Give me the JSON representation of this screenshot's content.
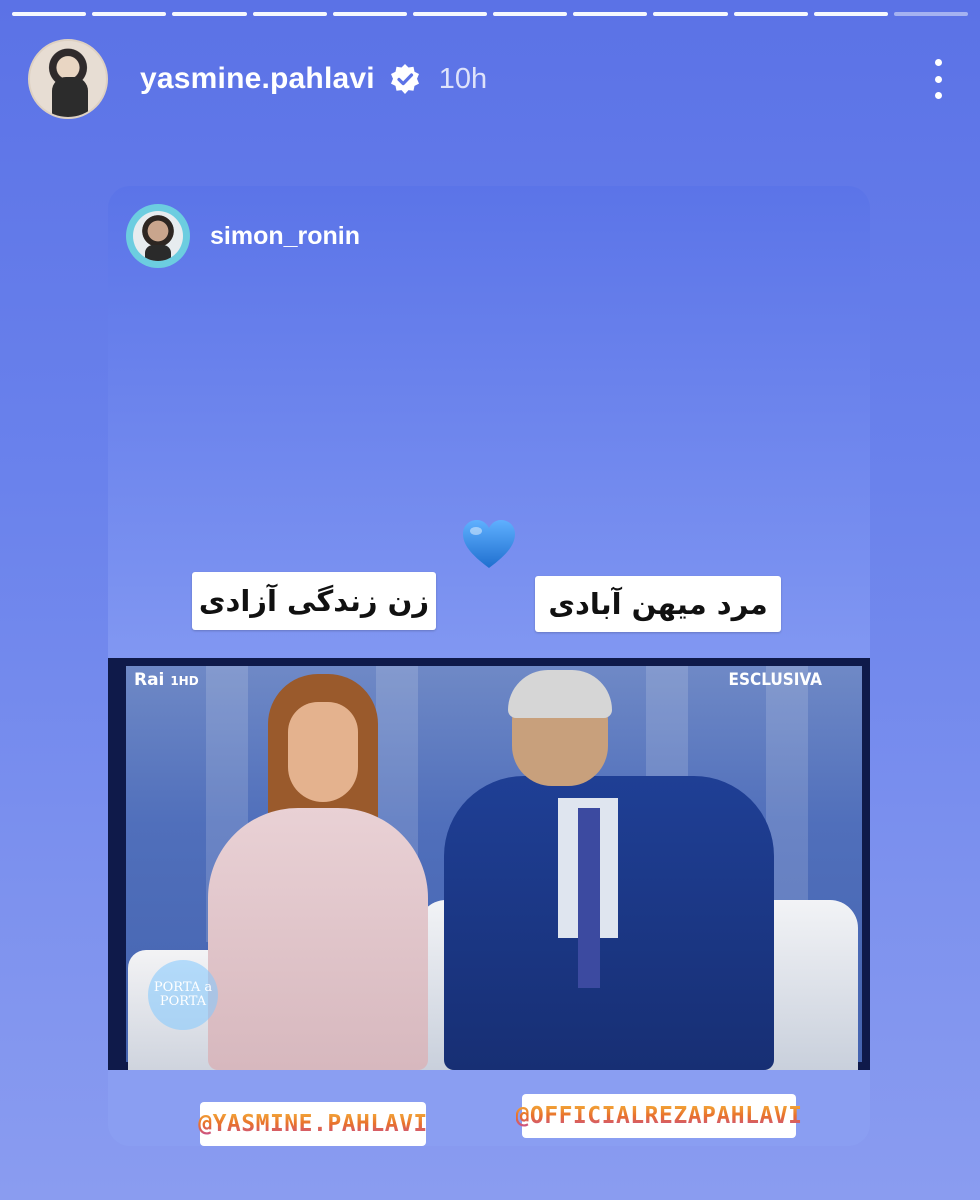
{
  "story": {
    "segments_total": 12,
    "author": "yasmine.pahlavi",
    "verified": true,
    "time": "10h"
  },
  "shared_post": {
    "author": "simon_ronin",
    "heart_emoji": "💙",
    "sticker_left": "زن زندگی آزادی",
    "sticker_right": "مرد میهن آبادی",
    "photo_overlay": {
      "channel": "Rai",
      "channel_suffix": "1HD",
      "badge": "ESCLUSIVA",
      "show_logo": "PORTA a PORTA"
    },
    "mention_left": "@YASMINE.PAHLAVI",
    "mention_right": "@OFFICIALREZAPAHLAVI"
  },
  "colors": {
    "background_top": "#5b72e6",
    "background_bottom": "#8a9cf0",
    "heart": "#3b8fe3",
    "verified_badge": "#ffffff"
  },
  "icons": {
    "verified": "verified-badge-icon",
    "menu": "more-vertical-icon",
    "heart": "blue-heart-icon"
  }
}
